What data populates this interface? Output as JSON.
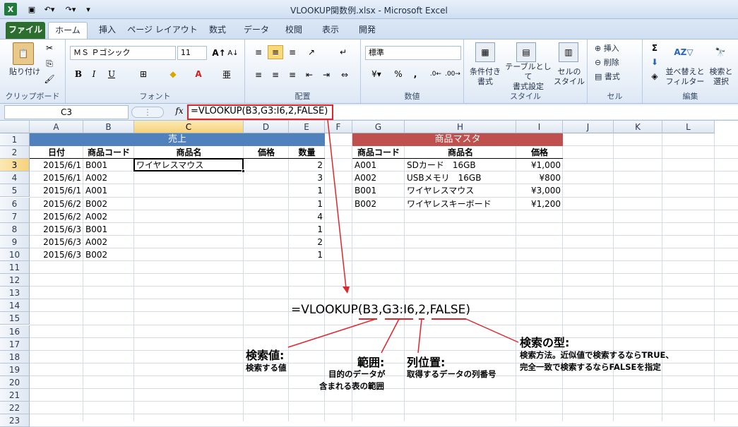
{
  "window": {
    "title": "VLOOKUP関数例.xlsx - Microsoft Excel"
  },
  "tabs": [
    "ファイル",
    "ホーム",
    "挿入",
    "ページ レイアウト",
    "数式",
    "データ",
    "校閲",
    "表示",
    "開発"
  ],
  "ribbon": {
    "clipboard": {
      "paste": "貼り付け",
      "label": "クリップボード"
    },
    "font": {
      "name": "ＭＳ Ｐゴシック",
      "size": "11",
      "label": "フォント",
      "bold": "B",
      "italic": "I",
      "underline": "U"
    },
    "alignment": {
      "label": "配置"
    },
    "number": {
      "format": "標準",
      "label": "数値",
      "percent": "%",
      "comma": ","
    },
    "styles": {
      "cond_format": "条件付き\n書式",
      "table_format": "テーブルとして\n書式設定",
      "cell_style": "セルの\nスタイル",
      "label": "スタイル"
    },
    "cells": {
      "insert": "挿入",
      "delete": "削除",
      "format": "書式",
      "label": "セル"
    },
    "editing": {
      "sum": "Σ",
      "sort": "並べ替えと\nフィルター",
      "find": "検索と\n選択",
      "label": "編集"
    }
  },
  "formula_bar": {
    "name_box": "C3",
    "fx": "fx",
    "formula": "=VLOOKUP(B3,G3:I6,2,FALSE)"
  },
  "columns": [
    "A",
    "B",
    "C",
    "D",
    "E",
    "F",
    "G",
    "H",
    "I",
    "J",
    "K",
    "L"
  ],
  "rows": [
    "1",
    "2",
    "3",
    "4",
    "5",
    "6",
    "7",
    "8",
    "9",
    "10",
    "11",
    "12",
    "13",
    "14",
    "15",
    "16",
    "17",
    "18",
    "19",
    "20",
    "21",
    "22",
    "23"
  ],
  "sales": {
    "title": "売上",
    "headers": [
      "日付",
      "商品コード",
      "商品名",
      "価格",
      "数量"
    ],
    "rows": [
      {
        "date": "2015/6/1",
        "code": "B001",
        "name": "ワイヤレスマウス",
        "qty": "2"
      },
      {
        "date": "2015/6/1",
        "code": "A002",
        "name": "",
        "qty": "3"
      },
      {
        "date": "2015/6/1",
        "code": "A001",
        "name": "",
        "qty": "1"
      },
      {
        "date": "2015/6/2",
        "code": "B002",
        "name": "",
        "qty": "1"
      },
      {
        "date": "2015/6/2",
        "code": "A002",
        "name": "",
        "qty": "4"
      },
      {
        "date": "2015/6/3",
        "code": "B001",
        "name": "",
        "qty": "1"
      },
      {
        "date": "2015/6/3",
        "code": "A002",
        "name": "",
        "qty": "2"
      },
      {
        "date": "2015/6/3",
        "code": "B002",
        "name": "",
        "qty": "1"
      }
    ]
  },
  "master": {
    "title": "商品マスタ",
    "headers": [
      "商品コード",
      "商品名",
      "価格"
    ],
    "rows": [
      {
        "code": "A001",
        "name": "SDカード　16GB",
        "price": "¥1,000"
      },
      {
        "code": "A002",
        "name": "USBメモリ　16GB",
        "price": "¥800"
      },
      {
        "code": "B001",
        "name": "ワイヤレスマウス",
        "price": "¥3,000"
      },
      {
        "code": "B002",
        "name": "ワイヤレスキーボード",
        "price": "¥1,200"
      }
    ]
  },
  "annotation": {
    "formula": "=VLOOKUP(B3,G3:I6,2,FALSE)",
    "lookup_value": {
      "title": "検索値:",
      "desc": "検索する値"
    },
    "range": {
      "title": "範囲:",
      "desc1": "目的のデータが",
      "desc2": "含まれる表の範囲"
    },
    "col_index": {
      "title": "列位置:",
      "desc": "取得するデータの列番号"
    },
    "match_type": {
      "title": "検索の型:",
      "desc1": "検索方法。近似値で検索するならTRUE、",
      "desc2": "完全一致で検索するならFALSEを指定"
    }
  },
  "colors": {
    "sales_header": "#4f81bd",
    "master_header": "#c0504d",
    "file_tab": "#2b6e2e",
    "highlight": "#e0262b"
  }
}
